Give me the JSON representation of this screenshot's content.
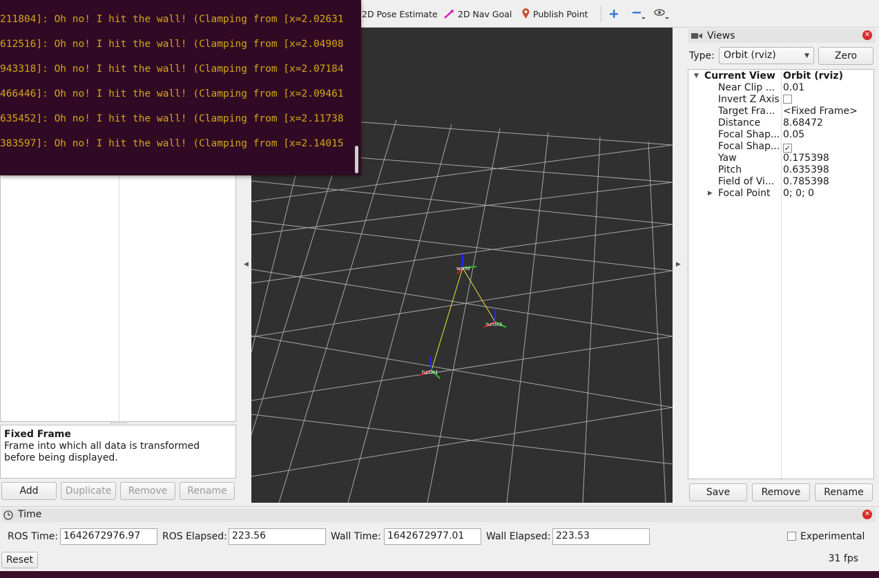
{
  "toolbar": {
    "pose_estimate_label": "2D Pose Estimate",
    "nav_goal_label": "2D Nav Goal",
    "publish_point_label": "Publish Point"
  },
  "terminal": {
    "lines": [
      "211804]: Oh no! I hit the wall! (Clamping from [x=2.02631",
      "612516]: Oh no! I hit the wall! (Clamping from [x=2.04908",
      "943318]: Oh no! I hit the wall! (Clamping from [x=2.07184",
      "466446]: Oh no! I hit the wall! (Clamping from [x=2.09461",
      "635452]: Oh no! I hit the wall! (Clamping from [x=2.11738",
      "383597]: Oh no! I hit the wall! (Clamping from [x=2.14015"
    ]
  },
  "displays": {
    "description_title": "Fixed Frame",
    "description_text": "Frame into which all data is transformed before being displayed.",
    "buttons": {
      "add": "Add",
      "duplicate": "Duplicate",
      "remove": "Remove",
      "rename": "Rename"
    }
  },
  "scene": {
    "frames": [
      "world",
      "turtle2",
      "turtle1"
    ]
  },
  "views": {
    "title": "Views",
    "type_label": "Type:",
    "type_value": "Orbit (rviz)",
    "zero_button": "Zero",
    "current_view": {
      "key": "Current View",
      "value": "Orbit (rviz)"
    },
    "properties": [
      {
        "key": "Near Clip ...",
        "value": "0.01"
      },
      {
        "key": "Invert Z Axis",
        "value": "",
        "checkbox": false
      },
      {
        "key": "Target Fra...",
        "value": "<Fixed Frame>"
      },
      {
        "key": "Distance",
        "value": "8.68472"
      },
      {
        "key": "Focal Shap...",
        "value": "0.05"
      },
      {
        "key": "Focal Shap...",
        "value": "",
        "checkbox": true
      },
      {
        "key": "Yaw",
        "value": "0.175398"
      },
      {
        "key": "Pitch",
        "value": "0.635398"
      },
      {
        "key": "Field of Vi...",
        "value": "0.785398"
      },
      {
        "key": "Focal Point",
        "value": "0; 0; 0"
      }
    ],
    "buttons": {
      "save": "Save",
      "remove": "Remove",
      "rename": "Rename"
    }
  },
  "time": {
    "title": "Time",
    "ros_time_label": "ROS Time:",
    "ros_time": "1642672976.97",
    "ros_elapsed_label": "ROS Elapsed:",
    "ros_elapsed": "223.56",
    "wall_time_label": "Wall Time:",
    "wall_time": "1642672977.01",
    "wall_elapsed_label": "Wall Elapsed:",
    "wall_elapsed": "223.53",
    "experimental_label": "Experimental",
    "reset_button": "Reset",
    "fps": "31 fps"
  }
}
